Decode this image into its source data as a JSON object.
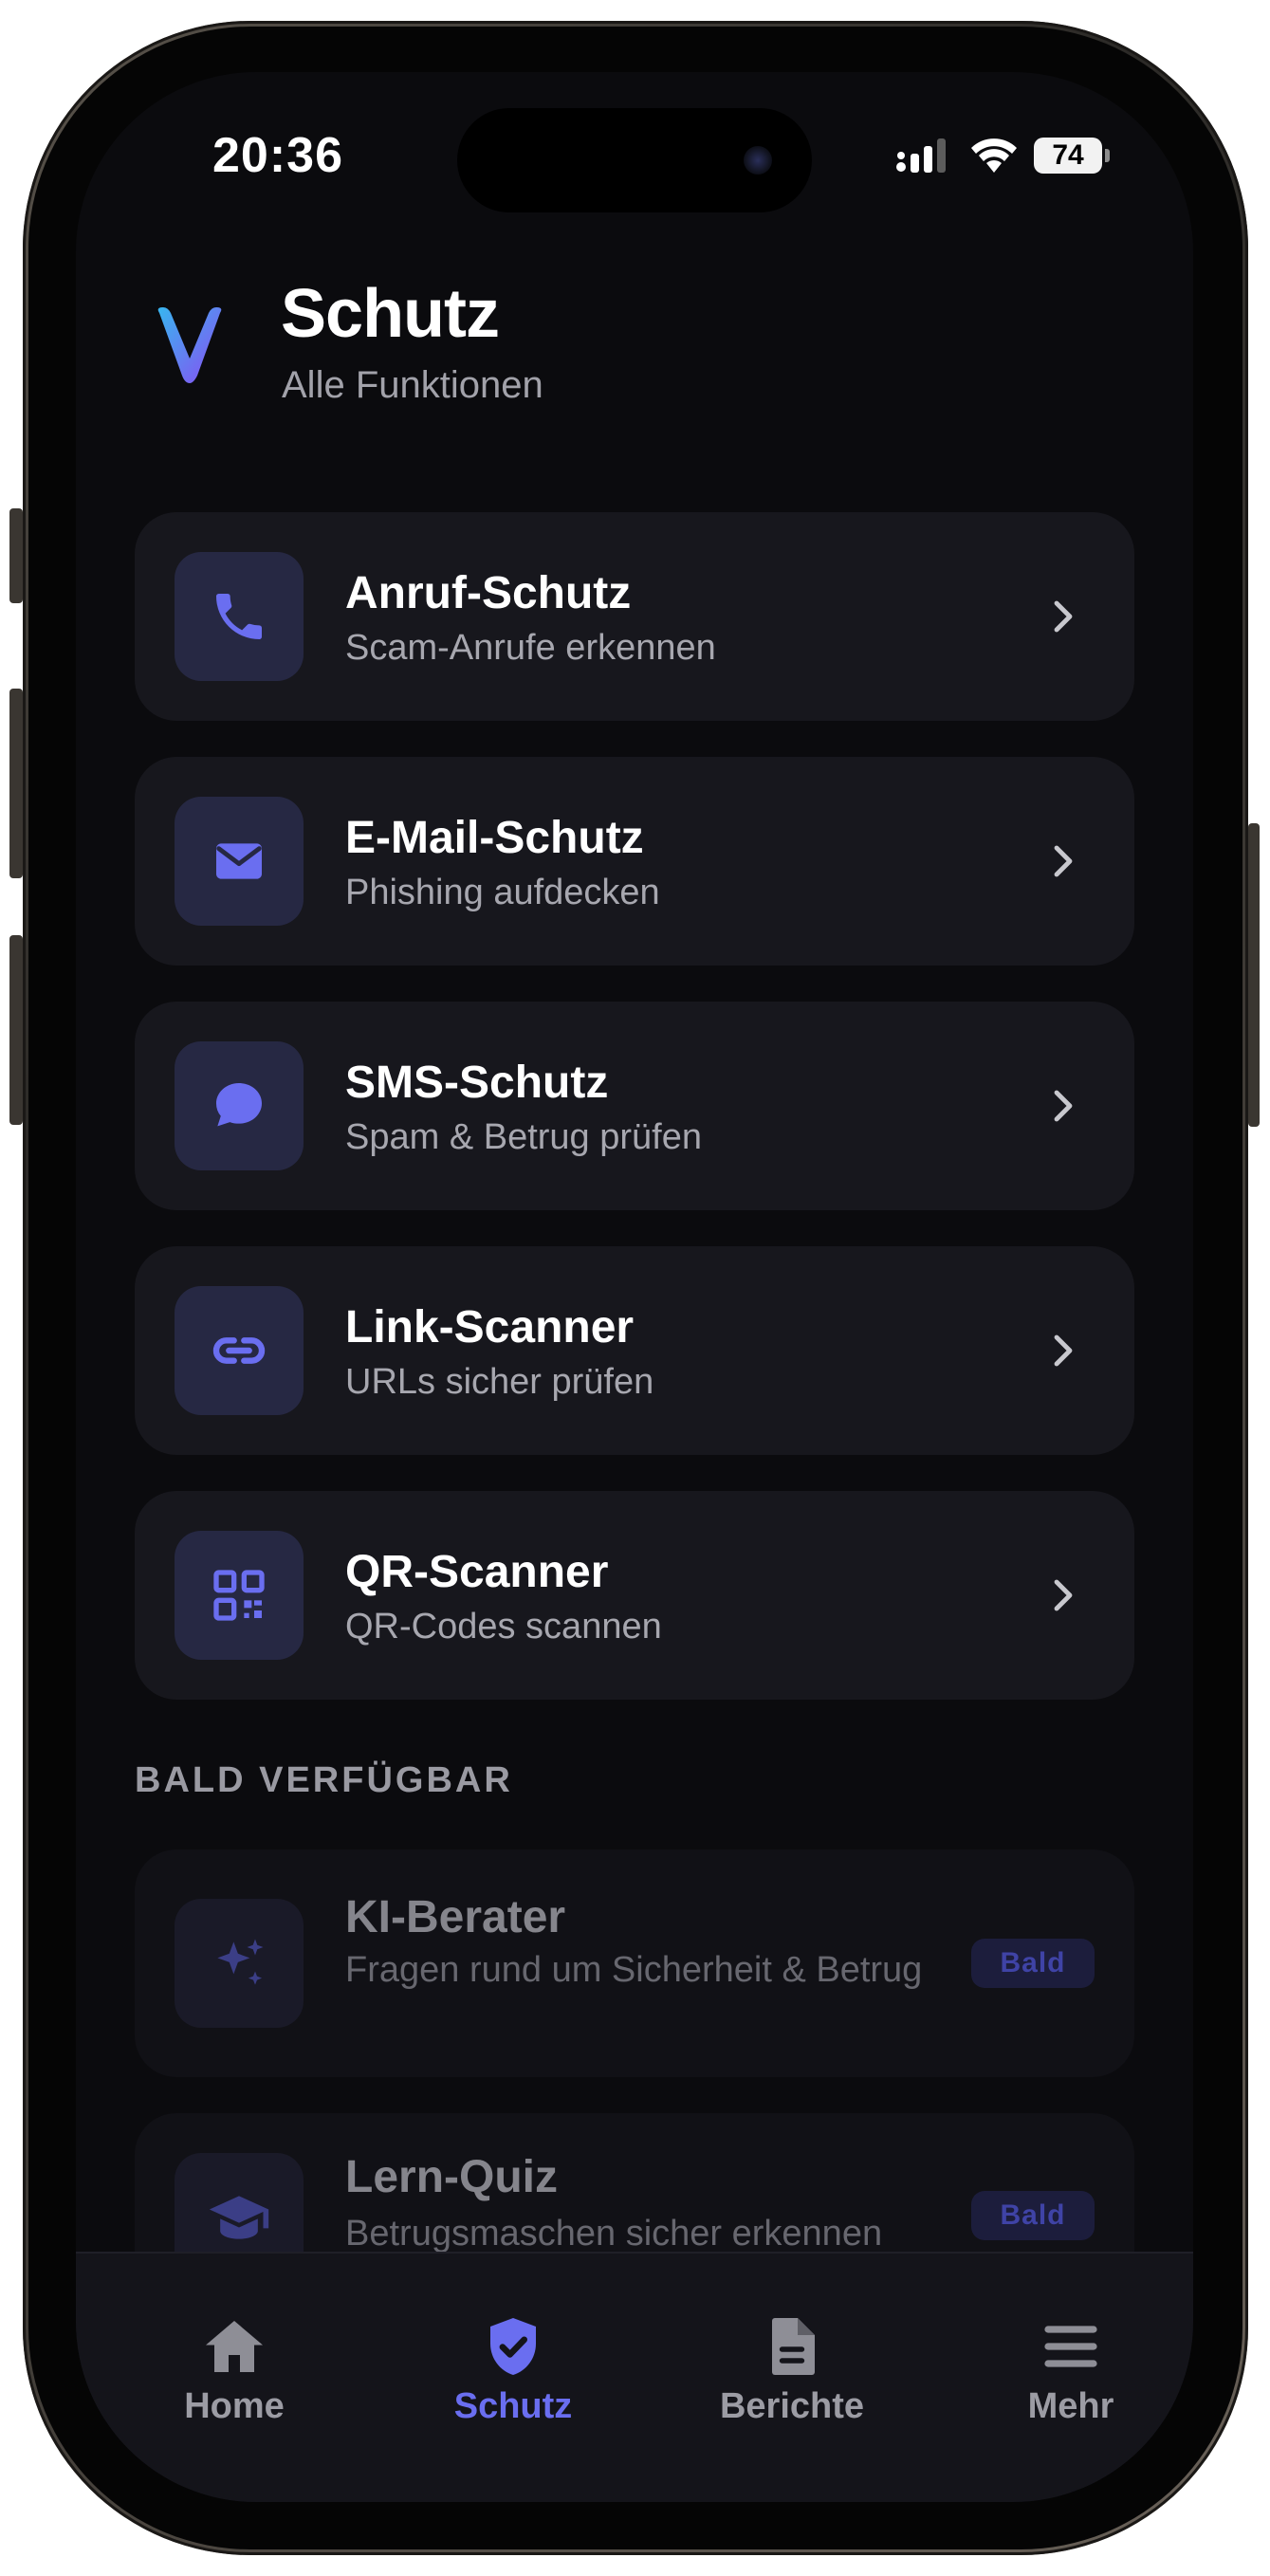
{
  "status_bar": {
    "time": "20:36",
    "battery": "74"
  },
  "header": {
    "title": "Schutz",
    "subtitle": "Alle Funktionen"
  },
  "features": [
    {
      "title": "Anruf-Schutz",
      "subtitle": "Scam-Anrufe erkennen",
      "icon": "phone-icon"
    },
    {
      "title": "E-Mail-Schutz",
      "subtitle": "Phishing aufdecken",
      "icon": "mail-icon"
    },
    {
      "title": "SMS-Schutz",
      "subtitle": "Spam & Betrug prüfen",
      "icon": "chat-bubble-icon"
    },
    {
      "title": "Link-Scanner",
      "subtitle": "URLs sicher prüfen",
      "icon": "link-icon"
    },
    {
      "title": "QR-Scanner",
      "subtitle": "QR-Codes scannen",
      "icon": "qr-code-icon"
    }
  ],
  "coming_soon": {
    "label": "BALD VERFÜGBAR",
    "items": [
      {
        "title": "KI-Berater",
        "subtitle": "Fragen rund um Sicherheit & Betrug",
        "badge": "Bald",
        "icon": "sparkles-icon"
      },
      {
        "title": "Lern-Quiz",
        "subtitle": "Betrugsmaschen sicher erkennen",
        "badge": "Bald",
        "icon": "graduation-cap-icon"
      }
    ]
  },
  "tabbar": {
    "tabs": [
      {
        "label": "Home",
        "icon": "home-icon",
        "active": false
      },
      {
        "label": "Schutz",
        "icon": "shield-check-icon",
        "active": true
      },
      {
        "label": "Berichte",
        "icon": "document-icon",
        "active": false
      },
      {
        "label": "Mehr",
        "icon": "menu-icon",
        "active": false
      }
    ]
  },
  "colors": {
    "accent": "#6a6ef0",
    "background": "#0b0b0e",
    "card": "#17171d",
    "icon_bg": "#262843"
  }
}
